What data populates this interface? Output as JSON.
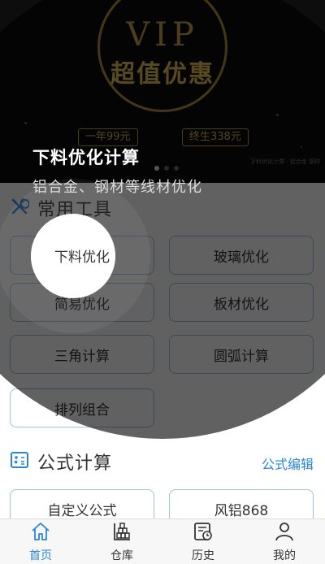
{
  "banner": {
    "vip": "VIP",
    "headline": "超值优惠",
    "price_year": "一年99元",
    "price_life": "终生338元",
    "note": "下料优化计算 · 铝合金 钢材"
  },
  "guide": {
    "title": "下料优化计算",
    "desc": "铝合金、钢材等线材优化"
  },
  "tools_section": {
    "title": "常用工具",
    "icon": "tools-icon",
    "items": [
      "下料优化",
      "玻璃优化",
      "简易优化",
      "板材优化",
      "三角计算",
      "圆弧计算",
      "排列组合"
    ]
  },
  "formula_section": {
    "title": "公式计算",
    "icon": "calculator-icon",
    "edit_label": "公式编辑",
    "items": [
      "自定义公式",
      "风铝868"
    ]
  },
  "nav": {
    "items": [
      {
        "label": "首页",
        "icon": "home-icon"
      },
      {
        "label": "仓库",
        "icon": "warehouse-icon"
      },
      {
        "label": "历史",
        "icon": "history-icon"
      },
      {
        "label": "我的",
        "icon": "profile-icon"
      }
    ]
  },
  "colors": {
    "accent": "#2a87d8",
    "button_border": "#9cc4dd",
    "overlay": "rgba(0,0,0,0.62)",
    "gold": "#c9a24b"
  }
}
